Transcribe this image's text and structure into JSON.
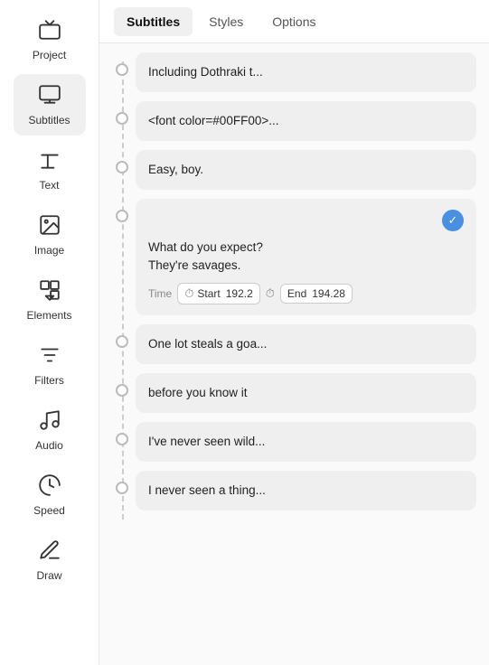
{
  "sidebar": {
    "items": [
      {
        "id": "project",
        "label": "Project",
        "icon": "🎬"
      },
      {
        "id": "subtitles",
        "label": "Subtitles",
        "icon": "⊟",
        "active": true
      },
      {
        "id": "text",
        "label": "Text",
        "icon": "⊤"
      },
      {
        "id": "image",
        "label": "Image",
        "icon": "🖼"
      },
      {
        "id": "elements",
        "label": "Elements",
        "icon": "◻"
      },
      {
        "id": "filters",
        "label": "Filters",
        "icon": "≡"
      },
      {
        "id": "audio",
        "label": "Audio",
        "icon": "♪"
      },
      {
        "id": "speed",
        "label": "Speed",
        "icon": "◎"
      },
      {
        "id": "draw",
        "label": "Draw",
        "icon": "✏"
      }
    ]
  },
  "tabs": [
    {
      "id": "subtitles",
      "label": "Subtitles",
      "active": true
    },
    {
      "id": "styles",
      "label": "Styles",
      "active": false
    },
    {
      "id": "options",
      "label": "Options",
      "active": false
    }
  ],
  "subtitles": [
    {
      "id": 1,
      "text": "Including Dothraki t...",
      "active": false,
      "showTime": false
    },
    {
      "id": 2,
      "text": "<font color=#00FF00>...",
      "active": false,
      "showTime": false
    },
    {
      "id": 3,
      "text": "Easy, boy.",
      "active": false,
      "showTime": false
    },
    {
      "id": 4,
      "text": "What do you expect?\nThey're savages.",
      "active": true,
      "showTime": true,
      "timeLabel": "Time",
      "startLabel": "Start",
      "startValue": "192.2",
      "endLabel": "End",
      "endValue": "194.28"
    },
    {
      "id": 5,
      "text": "One lot steals a goa...",
      "active": false,
      "showTime": false
    },
    {
      "id": 6,
      "text": "before you know it",
      "active": false,
      "showTime": false
    },
    {
      "id": 7,
      "text": "I've never seen wild...",
      "active": false,
      "showTime": false
    },
    {
      "id": 8,
      "text": "I never seen a thing...",
      "active": false,
      "showTime": false
    }
  ]
}
